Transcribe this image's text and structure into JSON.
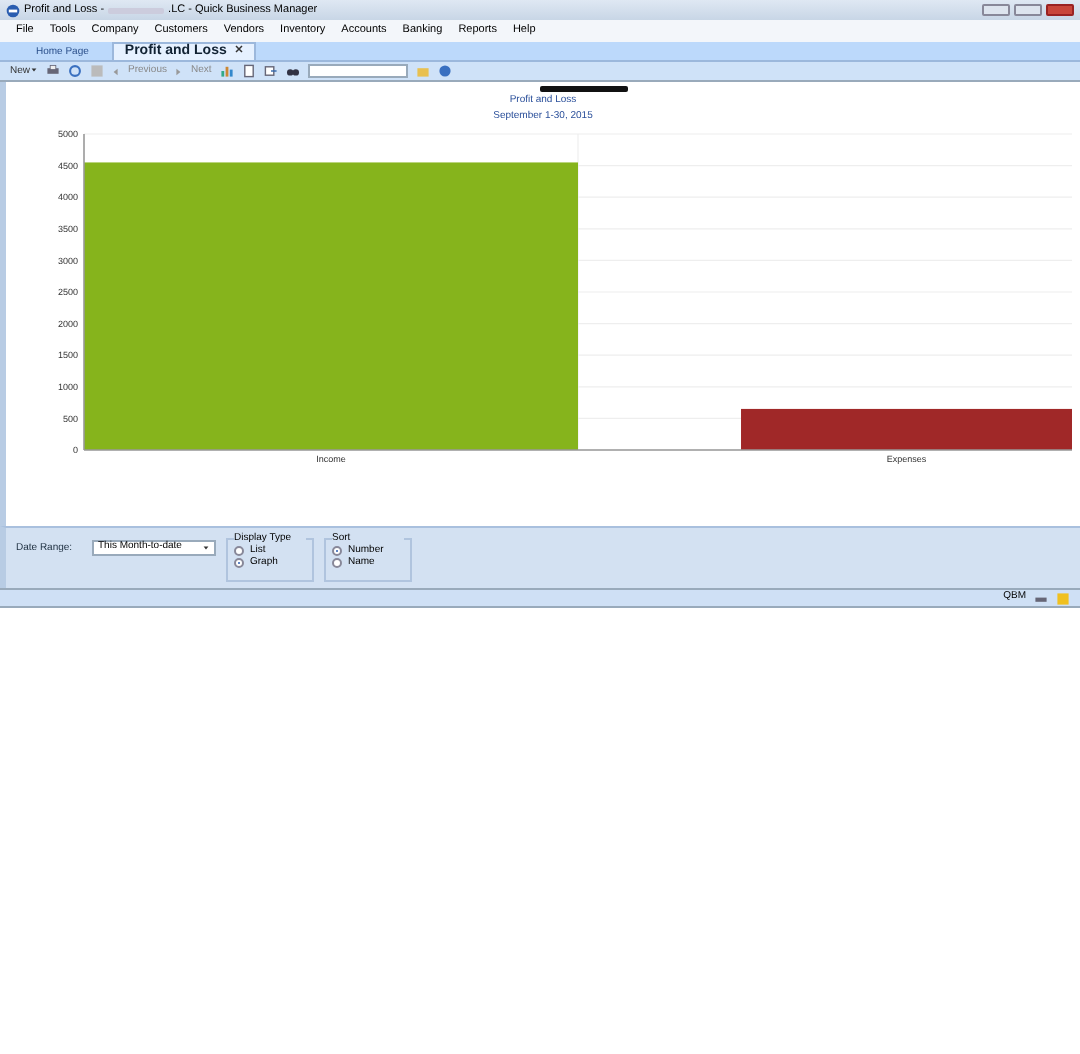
{
  "window": {
    "title_start": "Profit and Loss -",
    "title_end": ".LC - Quick Business Manager"
  },
  "menu": [
    "File",
    "Tools",
    "Company",
    "Customers",
    "Vendors",
    "Inventory",
    "Accounts",
    "Banking",
    "Reports",
    "Help"
  ],
  "tabs": [
    {
      "label": "Home Page",
      "selected": false,
      "closable": false
    },
    {
      "label": "Profit and Loss",
      "selected": true,
      "closable": true
    }
  ],
  "toolbar": {
    "new": "New",
    "previous": "Previous",
    "next": "Next"
  },
  "report": {
    "title": "Profit and Loss",
    "period": "September 1-30, 2015",
    "chart_data": {
      "type": "bar",
      "categories": [
        "Income",
        "Expenses"
      ],
      "grid": true,
      "series": [
        {
          "color": "#86b41c",
          "values": [
            4550,
            null
          ]
        },
        {
          "color": "#a02828",
          "values": [
            null,
            650
          ]
        }
      ],
      "ylim": [
        0,
        5000
      ],
      "yticks": [
        0,
        500,
        1000,
        1500,
        2000,
        2500,
        3000,
        3500,
        4000,
        4500,
        5000
      ]
    }
  },
  "options": {
    "date_range_label": "Date Range:",
    "date_range": "This Month-to-date",
    "display_type": {
      "label": "Display Type",
      "choices": [
        {
          "label": "List",
          "selected": false
        },
        {
          "label": "Graph",
          "selected": true
        }
      ]
    },
    "sort": {
      "label": "Sort",
      "choices": [
        {
          "label": "Number",
          "selected": true
        },
        {
          "label": "Name",
          "selected": false
        }
      ]
    }
  },
  "status_bar": {
    "text": "QBM"
  }
}
